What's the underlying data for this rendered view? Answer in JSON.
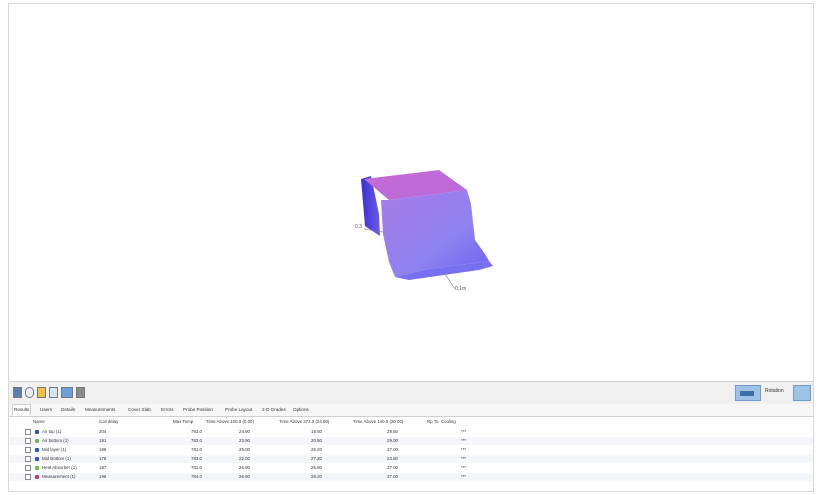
{
  "toolbar": {
    "icons": [
      "3d-view-icon",
      "rotate-icon",
      "bar-chart-icon",
      "graph-icon",
      "image-icon",
      "stack-icon"
    ],
    "right_label": "Rotation"
  },
  "tabs": [
    "Results",
    "Users",
    "Details",
    "Measurements",
    "Cover Slab",
    "Errors",
    "Probe Position",
    "Probe Layout",
    "2-D Grades",
    "Options"
  ],
  "table": {
    "headers": [
      "Name",
      "Coil delay",
      "Max Temp",
      "Time Above 100.0 (0.00)",
      "Time Above 372.0 (24.90)",
      "Time Above 140.0 (20.00)",
      "Rp To. Cooling"
    ],
    "rows": [
      {
        "name": "Air top (1)",
        "color": "#2d54c7",
        "values": [
          "204",
          "783.0",
          "24.90",
          "19.50",
          "29.50",
          "***"
        ]
      },
      {
        "name": "Air bottom (1)",
        "color": "#6bbf4a",
        "values": [
          "191",
          "783.0",
          "23.90",
          "20.50",
          "29.00",
          "***"
        ]
      },
      {
        "name": "Mid layer (1)",
        "color": "#2d54c7",
        "values": [
          "186",
          "781.0",
          "25.00",
          "26.20",
          "27.00",
          "***"
        ]
      },
      {
        "name": "Mid Bottom (1)",
        "color": "#2d54c7",
        "values": [
          "178",
          "783.0",
          "22.00",
          "27.20",
          "23.80",
          "***"
        ]
      },
      {
        "name": "Heat Absorber (1)",
        "color": "#6bbf4a",
        "values": [
          "187",
          "781.0",
          "26.90",
          "26.50",
          "27.00",
          "***"
        ]
      },
      {
        "name": "Measurement (1)",
        "color": "#c73d6a",
        "values": [
          "196",
          "784.0",
          "26.90",
          "29.20",
          "27.00",
          "***"
        ]
      }
    ]
  },
  "viewport": {
    "axis_label_left": "0.3",
    "axis_label_right": "0.1m"
  },
  "colors": {
    "surface_top": "#c66bd6",
    "surface_side": "#8f7cf2",
    "surface_dark": "#3a2fd1",
    "accent": "#9ec1e6"
  }
}
